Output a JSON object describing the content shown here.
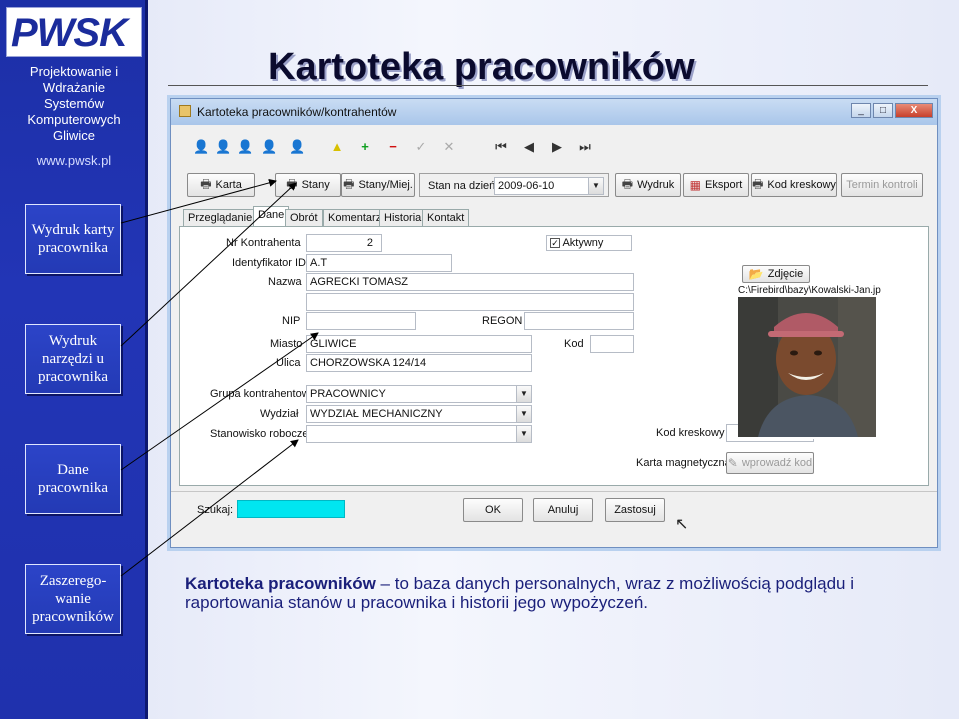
{
  "slide_title": "Kartoteka pracowników",
  "sidebar": {
    "logo": "PWSK",
    "company_lines": [
      "Projektowanie i",
      "Wdrażanie",
      "Systemów",
      "Komputerowych",
      "Gliwice"
    ],
    "website": "www.pwsk.pl",
    "buttons": [
      {
        "label": "Wydruk karty pracownika"
      },
      {
        "label": "Wydruk narzędzi u pracownika"
      },
      {
        "label": "Dane pracownika"
      },
      {
        "label": "Zaszerego-wanie pracowników"
      }
    ]
  },
  "window": {
    "title": "Kartoteka pracowników/kontrahentów",
    "controls": {
      "minimize": "_",
      "maximize": "□",
      "close": "X"
    },
    "toolbar_icons": [
      "person-icon",
      "person-icon",
      "person-icon",
      "person-icon",
      "person-icon",
      "arrow-up-icon",
      "plus-icon",
      "minus-icon",
      "check-icon",
      "cancel-icon",
      "first-icon",
      "prev-icon",
      "next-icon",
      "last-icon"
    ],
    "buttons": {
      "karta": "Karta",
      "stany": "Stany",
      "stany_miej": "Stany/Miej.",
      "stan_na_dzien_label": "Stan na dzień:",
      "stan_na_dzien_value": "2009-06-10",
      "wydruk": "Wydruk",
      "eksport": "Eksport",
      "kod_kreskowy": "Kod kreskowy",
      "termin_kontroli": "Termin kontroli"
    },
    "tabs": [
      "Przeglądanie",
      "Dane",
      "Obrót",
      "Komentarz",
      "Historia",
      "Kontakt"
    ],
    "active_tab": "Dane",
    "form": {
      "nr_kontrahenta_label": "Nr Kontrahenta",
      "nr_kontrahenta": "2",
      "aktywny_label": "Aktywny",
      "identyfikator_label": "Identyfikator ID",
      "identyfikator": "A.T",
      "nazwa_label": "Nazwa",
      "nazwa": "AGRECKI TOMASZ",
      "nip_label": "NIP",
      "regon_label": "REGON",
      "miasto_label": "Miasto",
      "miasto": "GLIWICE",
      "kod_label": "Kod",
      "ulica_label": "Ulica",
      "ulica": "CHORZOWSKA 124/14",
      "grupa_label": "Grupa kontrahentow",
      "grupa": "PRACOWNICY",
      "wydzial_label": "Wydział",
      "wydzial": "WYDZIAŁ MECHANICZNY",
      "stanowisko_label": "Stanowisko robocze",
      "kod_kreskowy_label": "Kod kreskowy",
      "karta_magnetyczna_label": "Karta magnetyczna",
      "wprowadz_kod": "wprowadź kod",
      "zdjecie_button": "Zdjęcie",
      "zdjecie_path": "C:\\Firebird\\bazy\\Kowalski-Jan.jp"
    },
    "bottom": {
      "szukaj_label": "Szukaj:",
      "ok": "OK",
      "anuluj": "Anuluj",
      "zastosuj": "Zastosuj"
    }
  },
  "caption": {
    "bold": "Kartoteka pracowników",
    "rest": " – to baza danych personalnych, wraz z możliwością podglądu i raportowania stanów u pracownika i historii jego wypożyczeń."
  }
}
